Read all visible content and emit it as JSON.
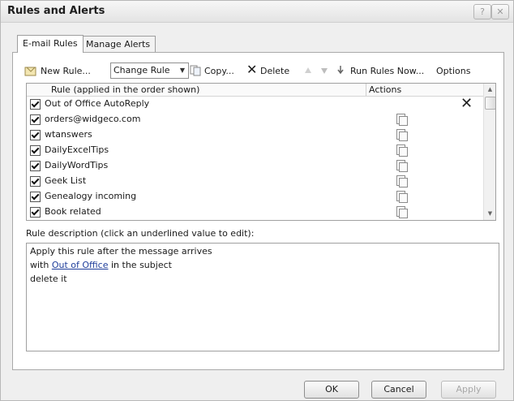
{
  "window": {
    "title": "Rules and Alerts",
    "help_glyph": "?",
    "close_glyph": "✕"
  },
  "tabs": [
    {
      "label": "E-mail Rules",
      "active": true
    },
    {
      "label": "Manage Alerts",
      "active": false
    }
  ],
  "toolbar": {
    "new_rule": "New Rule...",
    "change_rule": "Change Rule",
    "copy": "Copy...",
    "delete": "Delete",
    "run_rules_now": "Run Rules Now...",
    "options": "Options"
  },
  "rules_list": {
    "header_rule": "Rule (applied in the order shown)",
    "header_actions": "Actions",
    "rows": [
      {
        "name": "Out of Office AutoReply",
        "checked": true,
        "action": "delete-x-icon"
      },
      {
        "name": "orders@widgeco.com",
        "checked": true,
        "action": "move-to-folder-icon"
      },
      {
        "name": "wtanswers",
        "checked": true,
        "action": "move-to-folder-icon"
      },
      {
        "name": "DailyExcelTips",
        "checked": true,
        "action": "move-to-folder-icon"
      },
      {
        "name": "DailyWordTips",
        "checked": true,
        "action": "move-to-folder-icon"
      },
      {
        "name": "Geek List",
        "checked": true,
        "action": "move-to-folder-icon"
      },
      {
        "name": "Genealogy incoming",
        "checked": true,
        "action": "move-to-folder-icon"
      },
      {
        "name": "Book related",
        "checked": true,
        "action": "move-to-folder-icon"
      }
    ]
  },
  "description": {
    "label": "Rule description (click an underlined value to edit):",
    "line1": "Apply this rule after the message arrives",
    "line2_prefix": "with",
    "line2_link": "Out of Office",
    "line2_suffix": "in the subject",
    "line3": "delete it"
  },
  "buttons": {
    "ok": "OK",
    "cancel": "Cancel",
    "apply": "Apply"
  }
}
